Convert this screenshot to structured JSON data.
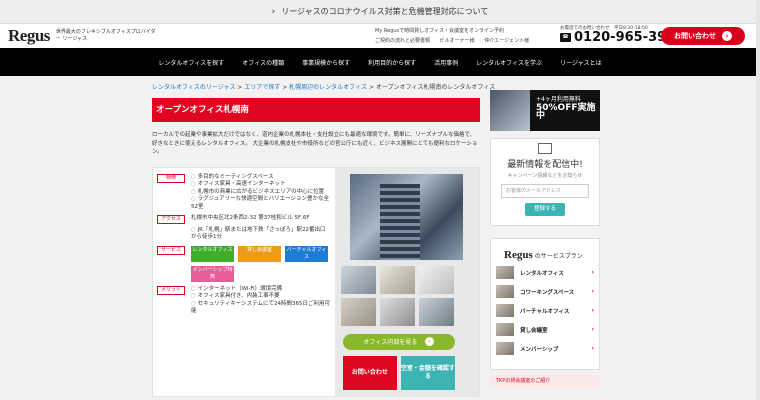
{
  "notice": {
    "text": "リージャスのコロナウイルス対策と危機管理対応について"
  },
  "header": {
    "logo": "Regus",
    "tagline": "世界最大のフレキシブルオフィスプロバイダー リージャス",
    "link_top": "My Regusで時間貸しオフィス・会議室をオンライン予約",
    "links": [
      "ご契約の流れと必要書類",
      "ビルオーナー様",
      "仲介エージェント様"
    ],
    "phone_note": "お電話でのお問い合わせ　平日8:30-18:00",
    "phone": "0120-965-391",
    "contact_label": "お問い合わせ"
  },
  "nav": {
    "items": [
      "レンタルオフィスを探す",
      "オフィスの種類",
      "事業規模から探す",
      "利用目的から探す",
      "活用事例",
      "レンタルオフィスを学ぶ",
      "リージャスとは"
    ]
  },
  "breadcrumb": {
    "items": [
      "レンタルオフィスのリージャス",
      "エリアで探す",
      "札幌周辺のレンタルオフィス"
    ],
    "current": "オープンオフィス札幌南のレンタルオフィス"
  },
  "page": {
    "title": "オープンオフィス札幌南",
    "intro": "ローカルでの起業や事業拡大だけではなく、道内企業の札幌本社・支社設立にも最適な環境です。簡単に、リーズナブルな価格で、好きなときに使えるレンタルオフィス。 大企業の札幌支社や市役所などの官公庁にも近く、ビジネス展開にとても便利なロケーション。"
  },
  "info": {
    "features_tag": "特徴",
    "features": [
      "多目的なミーティングスペース",
      "オフィス家具・高速インターネット",
      "札幌市の商業に広がるビジネスエリアの中心に位置",
      "ラグジュアリーな快適空間とバリエーション豊かな全52室"
    ],
    "access_tag": "アクセス",
    "address": "札幌市中央区北2条西2-32 第37桂和ビル 5F,6F",
    "access_items": [
      "JR「札幌」駅または地下鉄「さっぽろ」駅22番出口から徒歩1分"
    ],
    "services_tag": "サービス",
    "services": [
      "レンタルオフィス",
      "貸し会議室",
      "バーチャルオフィス",
      "メンバーシップ特典"
    ],
    "merits_tag": "メリット",
    "merits": [
      "インターネット（Wi-Fi）環境完備",
      "オフィス家具付き、内装工事不要",
      "セキュリティキーシステムにて24時間365日ご利用可能"
    ]
  },
  "gallery": {
    "see_inside": "オフィス内部を見る",
    "contact": "お問い合わせ",
    "availability": "空室・金額を確認する"
  },
  "sidebar": {
    "banner_line1": "+4ヶ月利用無料",
    "banner_line2": "50%OFF実施中",
    "news_title": "最新情報を配信中!",
    "news_sub": "キャンペーン情報などをお知らせ",
    "email_placeholder": "お客様のメールアドレス",
    "register": "登録する",
    "plan_logo": "Regus",
    "plan_title": "のサービスプラン",
    "plans": [
      "レンタルオフィス",
      "コワーキングスペース",
      "バーチャルオフィス",
      "貸し会議室",
      "メンバーシップ"
    ],
    "promo": "TKPの貸会議室のご紹介"
  },
  "colors": {
    "brand_red": "#e10620",
    "accent_green": "#8ab82d",
    "accent_teal": "#3cb4b4"
  }
}
